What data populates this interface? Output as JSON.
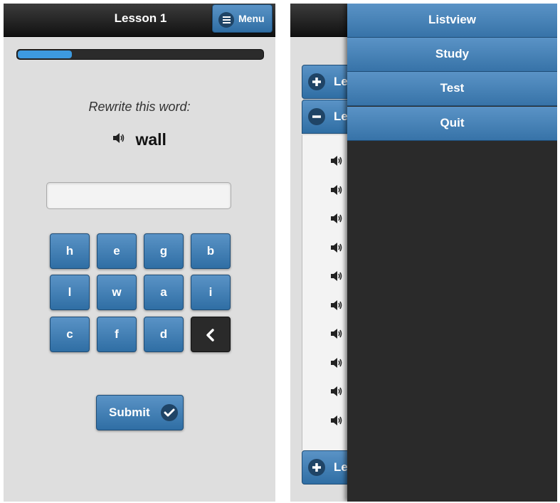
{
  "header": {
    "title": "Lesson 1",
    "menu_label": "Menu"
  },
  "progress": {
    "fraction": 0.22
  },
  "exercise": {
    "prompt": "Rewrite this word:",
    "word": "wall",
    "answer_value": "",
    "answer_placeholder": ""
  },
  "keyboard": {
    "keys": [
      "h",
      "e",
      "g",
      "b",
      "l",
      "w",
      "a",
      "i",
      "c",
      "f",
      "d"
    ],
    "backspace_icon": "chevron-left-icon"
  },
  "submit": {
    "label": "Submit",
    "icon": "check-icon"
  },
  "accordion": {
    "headers": [
      {
        "label": "Le",
        "icon": "plus-icon"
      },
      {
        "label": "Le",
        "icon": "minus-icon"
      },
      {
        "label": "Le",
        "icon": "plus-icon"
      }
    ],
    "speaker_count": 10
  },
  "drawer": {
    "items": [
      "Listview",
      "Study",
      "Test",
      "Quit"
    ]
  },
  "colors": {
    "accent": "#3773a8",
    "header": "#1a1a1a",
    "progress_fill": "#3d9ae0",
    "drawer_bg": "#2a2a2a"
  }
}
